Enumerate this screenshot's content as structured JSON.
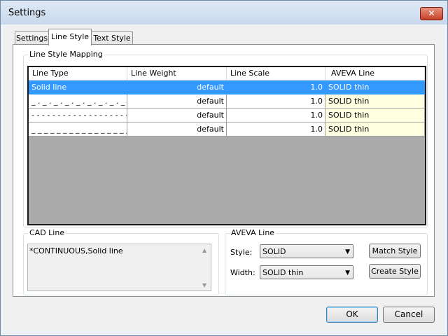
{
  "window": {
    "title": "Settings",
    "close_glyph": "✕"
  },
  "tabs": [
    {
      "label": "Settings"
    },
    {
      "label": "Line Style"
    },
    {
      "label": "Text Style"
    }
  ],
  "mapping_group": {
    "label": "Line Style Mapping",
    "columns": [
      "Line Type",
      "Line Weight",
      "Line Scale",
      "AVEVA Line"
    ],
    "rows": [
      {
        "line_type": "Solid line",
        "line_weight": "default",
        "line_scale": "1.0",
        "aveva_line": "SOLID thin",
        "selected": true
      },
      {
        "line_type": "_ . _ . _ . _ . _ . _ . _ . _ . _ . _ ...",
        "line_weight": "default",
        "line_scale": "1.0",
        "aveva_line": "SOLID thin",
        "selected": false
      },
      {
        "line_type": "- - - - - - - - - - - - - - - - - - - - -...",
        "line_weight": "default",
        "line_scale": "1.0",
        "aveva_line": "SOLID thin",
        "selected": false
      },
      {
        "line_type": "_ _ _ _ _ _ _ _ _ _ _ _ _ _ _ _ ...",
        "line_weight": "default",
        "line_scale": "1.0",
        "aveva_line": "SOLID thin",
        "selected": false
      }
    ]
  },
  "cad_line": {
    "label": "CAD Line",
    "value": "*CONTINUOUS,Solid line"
  },
  "aveva_line": {
    "label": "AVEVA Line",
    "style_label": "Style:",
    "style_value": "SOLID",
    "width_label": "Width:",
    "width_value": "SOLID thin",
    "match_button": "Match Style",
    "create_button": "Create Style"
  },
  "footer": {
    "ok": "OK",
    "cancel": "Cancel"
  },
  "colors": {
    "selection": "#3399ff",
    "aveva_cell": "#ffffe1",
    "grid_background": "#ababab"
  }
}
